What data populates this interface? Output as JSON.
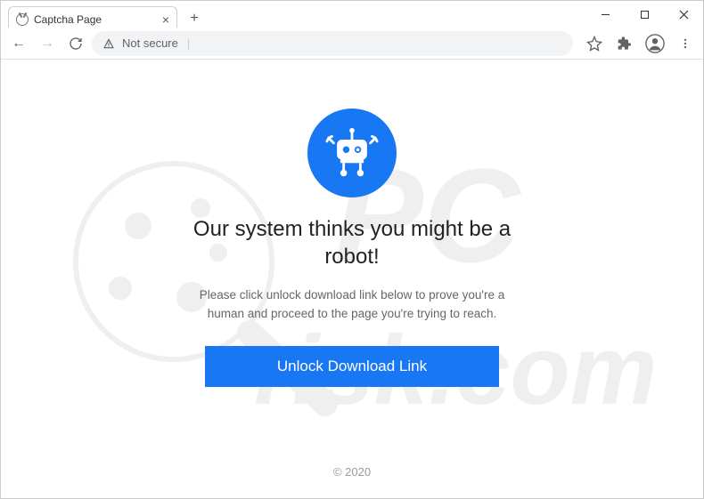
{
  "tab": {
    "title": "Captcha Page"
  },
  "address": {
    "security_label": "Not secure"
  },
  "page": {
    "headline": "Our system thinks you might be a robot!",
    "subtext": "Please click unlock download link below to prove you're a human and proceed to the page you're trying to reach.",
    "button_label": "Unlock Download Link",
    "copyright": "© 2020"
  },
  "watermark": {
    "text_top": "PC",
    "text_bottom": "risk.com"
  }
}
